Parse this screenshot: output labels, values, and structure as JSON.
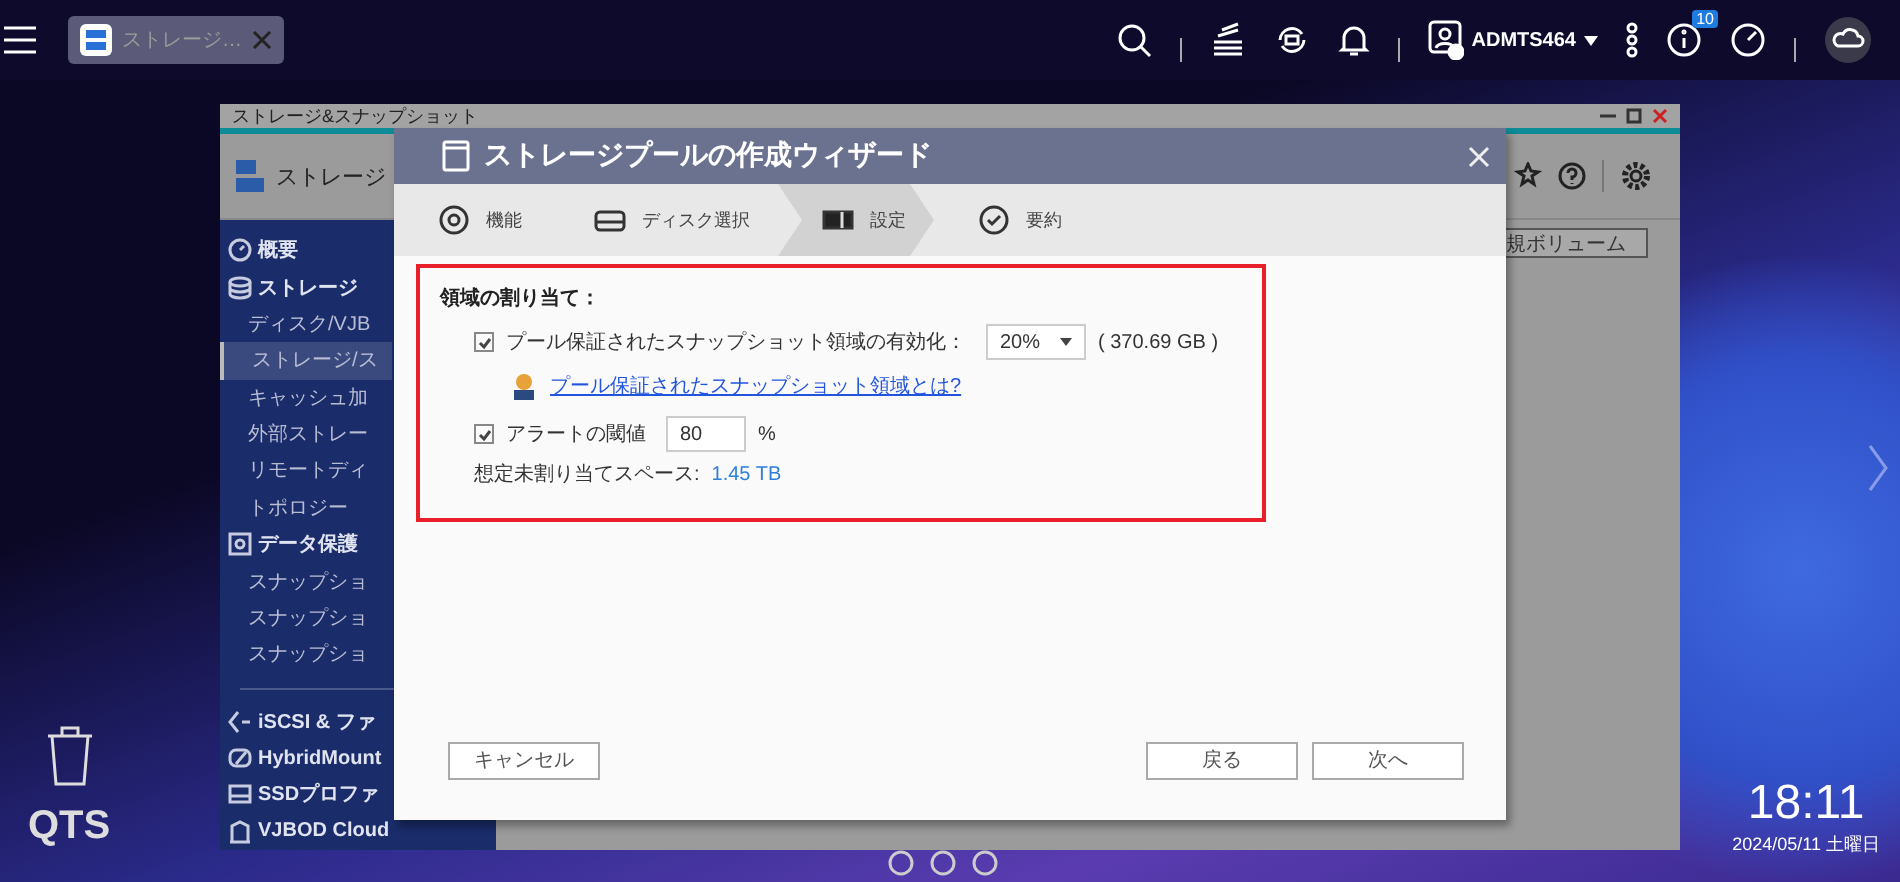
{
  "taskbar": {
    "tab": {
      "label": "ストレージ…",
      "selected": true
    },
    "user": "ADMTS464",
    "notification_badge": "10"
  },
  "app_window": {
    "title": "ストレージ&スナップショット",
    "header": "ストレージ",
    "toolbar_button": "規ボリューム",
    "sidebar": [
      {
        "kind": "section",
        "label": "概要",
        "selected": false
      },
      {
        "kind": "section",
        "label": "ストレージ",
        "selected": false
      },
      {
        "kind": "item",
        "label": "ディスク/VJB",
        "selected": false
      },
      {
        "kind": "item",
        "label": "ストレージ/ス",
        "selected": true
      },
      {
        "kind": "item",
        "label": "キャッシュ加",
        "selected": false
      },
      {
        "kind": "item",
        "label": "外部ストレー",
        "selected": false
      },
      {
        "kind": "item",
        "label": "リモートディ",
        "selected": false
      },
      {
        "kind": "item",
        "label": "トポロジー",
        "selected": false
      },
      {
        "kind": "section",
        "label": "データ保護",
        "selected": false
      },
      {
        "kind": "item",
        "label": "スナップショ",
        "selected": false
      },
      {
        "kind": "item",
        "label": "スナップショ",
        "selected": false
      },
      {
        "kind": "item",
        "label": "スナップショ",
        "selected": false
      },
      {
        "kind": "divider"
      },
      {
        "kind": "section",
        "label": "iSCSI & ファ",
        "selected": false
      },
      {
        "kind": "section",
        "label": "HybridMount",
        "selected": false
      },
      {
        "kind": "section",
        "label": "SSDプロファ",
        "selected": false
      },
      {
        "kind": "section",
        "label": "VJBOD Cloud",
        "selected": false
      }
    ]
  },
  "wizard": {
    "title": "ストレージプールの作成ウィザード",
    "steps": [
      {
        "label": "機能",
        "selected": false
      },
      {
        "label": "ディスク選択",
        "selected": false
      },
      {
        "label": "設定",
        "selected": true
      },
      {
        "label": "要約",
        "selected": false
      }
    ],
    "section_title": "領域の割り当て：",
    "snapshot_space": {
      "label": "プール保証されたスナップショット領域の有効化：",
      "checked": true,
      "value": "20%",
      "capacity": "( 370.69 GB )"
    },
    "help_link": "プール保証されたスナップショット領域とは?",
    "alert_threshold": {
      "label": "アラートの閾値",
      "checked": true,
      "value": "80",
      "unit": "%"
    },
    "estimate": {
      "label": "想定未割り当てスペース:",
      "value": "1.45 TB"
    },
    "buttons": {
      "cancel": "キャンセル",
      "back": "戻る",
      "next": "次へ"
    }
  },
  "desktop": {
    "logo": "QTS",
    "time": "18:11",
    "date": "2024/05/11 土曜日"
  }
}
